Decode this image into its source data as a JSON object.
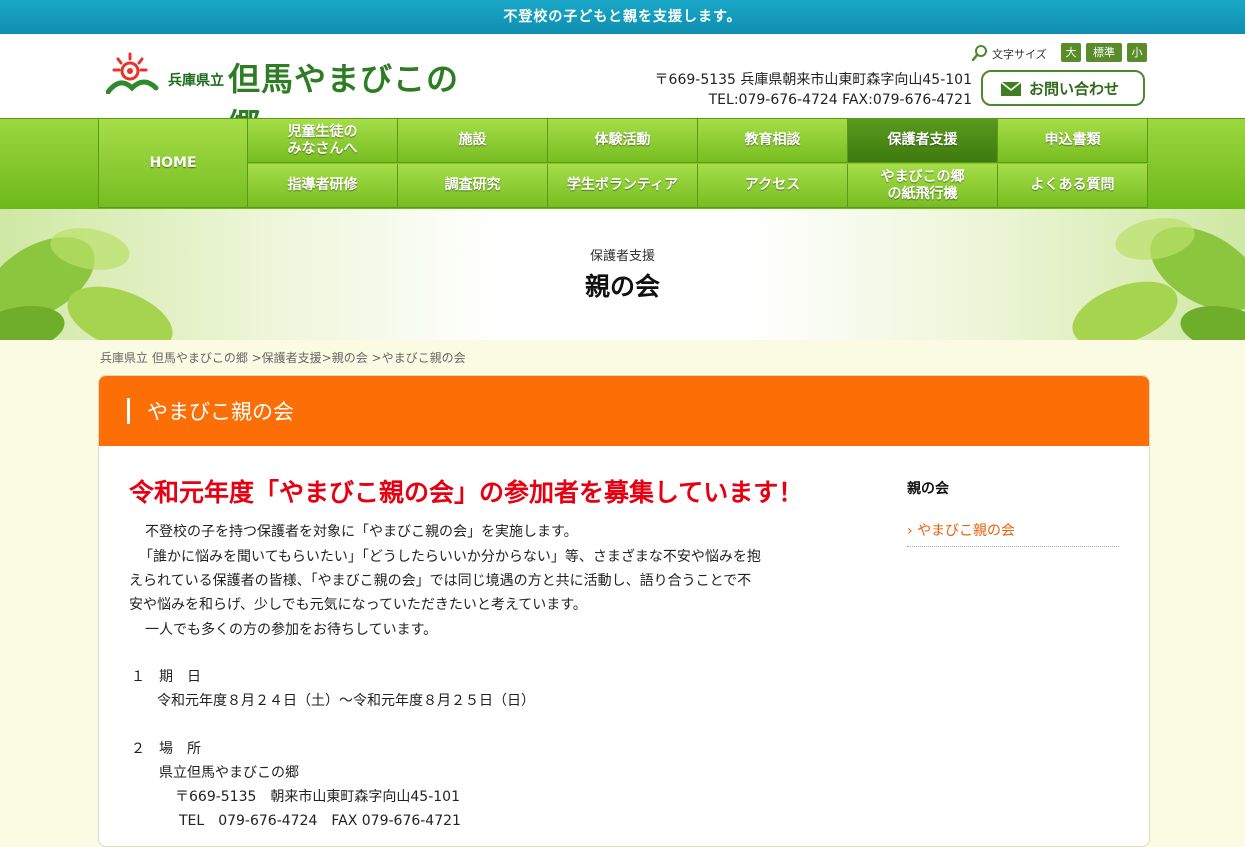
{
  "topbar": {
    "text": "不登校の子どもと親を支援します。"
  },
  "logo": {
    "small": "兵庫県立",
    "big": "但馬やまびこの郷"
  },
  "header": {
    "address": "〒669-5135 兵庫県朝来市山東町森字向山45-101",
    "phone_fax": "TEL:079-676-4724 FAX:079-676-4721",
    "font_size_label": "文字サイズ",
    "font_size_buttons": [
      "大",
      "標準",
      "小"
    ],
    "contact_label": "お問い合わせ"
  },
  "nav": {
    "home": "HOME",
    "row1": [
      "児童生徒の\nみなさんへ",
      "施設",
      "体験活動",
      "教育相談",
      "保護者支援",
      "申込書類"
    ],
    "row2": [
      "指導者研修",
      "調査研究",
      "学生ボランティア",
      "アクセス",
      "やまびこの郷\nの紙飛行機",
      "よくある質問"
    ],
    "active": "保護者支援"
  },
  "hero": {
    "subtitle": "保護者支援",
    "title": "親の会"
  },
  "breadcrumb": "兵庫県立 但馬やまびこの郷 >保護者支援>親の会 >やまびこ親の会",
  "panel": {
    "heading": "やまびこ親の会"
  },
  "article": {
    "title": "令和元年度「やまびこ親の会」の参加者を募集しています！",
    "lines": [
      "不登校の子を持つ保護者を対象に「やまびこ親の会」を実施します。",
      "「誰かに悩みを聞いてもらいたい」「どうしたらいいか分からない」等、さまざまな不安や悩みを抱",
      "えられている保護者の皆様、「やまびこ親の会」では同じ境遇の方と共に活動し、語り合うことで不",
      "安や悩みを和らげ、少しでも元気になっていただきたいと考えています。",
      "一人でも多くの方の参加をお待ちしています。"
    ],
    "item1_label": "１　期　日",
    "item1_value": "令和元年度８月２４日（土）〜令和元年度８月２５日（日）",
    "item2_label": "２　場　所",
    "item2_value": "県立但馬やまびこの郷",
    "item2_addr": "〒669-5135　朝来市山東町森字向山45-101",
    "item2_tel": "TEL　079-676-4724　FAX 079-676-4721"
  },
  "sidebar": {
    "heading": "親の会",
    "link": "やまびこ親の会"
  }
}
